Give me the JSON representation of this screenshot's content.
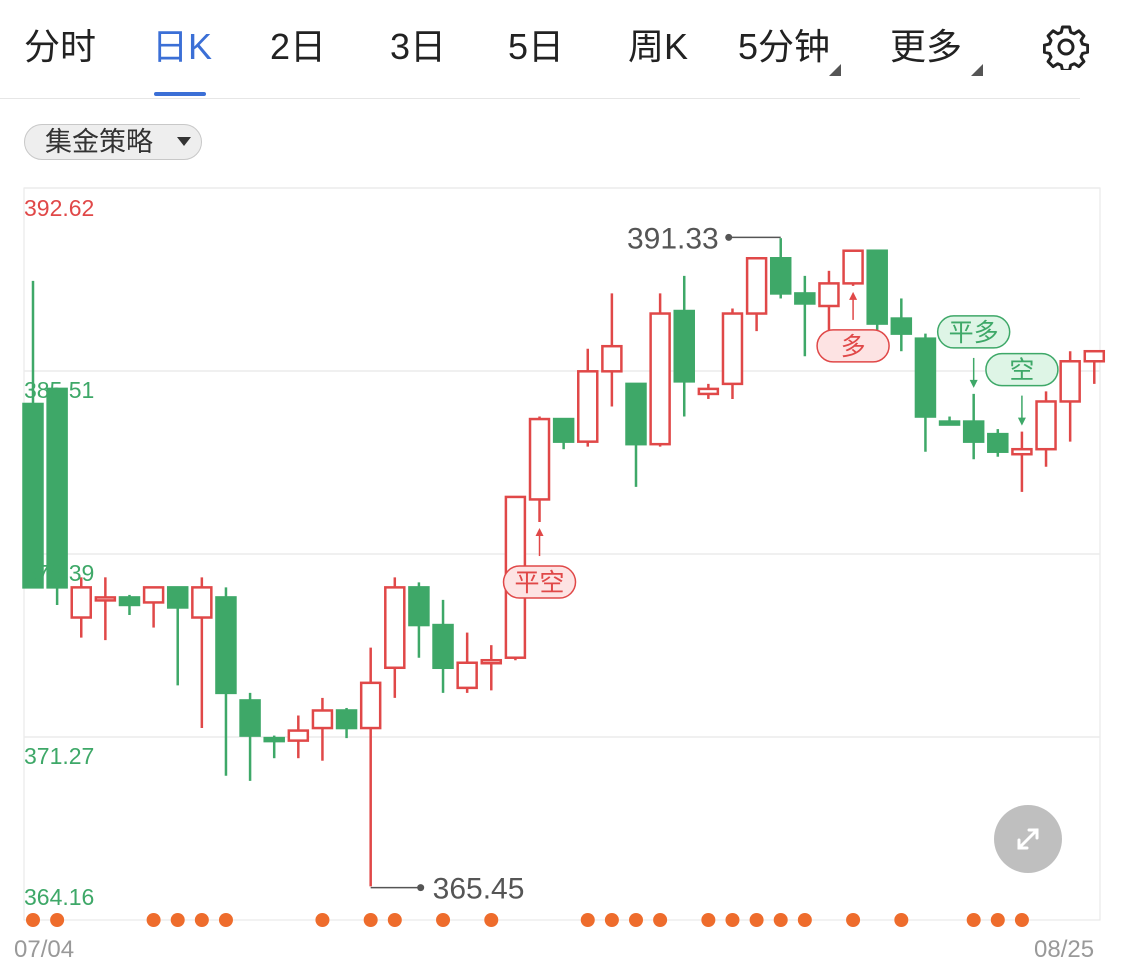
{
  "tabs": [
    {
      "label": "分时",
      "active": false,
      "has_menu": false
    },
    {
      "label": "日K",
      "active": true,
      "has_menu": false
    },
    {
      "label": "2日",
      "active": false,
      "has_menu": false
    },
    {
      "label": "3日",
      "active": false,
      "has_menu": false
    },
    {
      "label": "5日",
      "active": false,
      "has_menu": false
    },
    {
      "label": "周K",
      "active": false,
      "has_menu": false
    },
    {
      "label": "5分钟",
      "active": false,
      "has_menu": true
    },
    {
      "label": "更多",
      "active": false,
      "has_menu": true
    }
  ],
  "settings_icon": "gear-icon",
  "expand_icon": "expand-icon",
  "strategy_dropdown": {
    "label": "集金策略"
  },
  "colors": {
    "up": "#e04848",
    "down": "#3ea868",
    "accent": "#3b6fd6",
    "dot": "#ee6c2c",
    "signal_red_bg": "#fde3e3",
    "signal_green_bg": "#def5e6"
  },
  "chart_data": {
    "type": "candlestick",
    "title": "",
    "ylim": [
      364.16,
      392.62
    ],
    "y_ticks": [
      "392.62",
      "385.51",
      "378.39",
      "371.27",
      "364.16"
    ],
    "x_start_label": "07/04",
    "x_end_label": "08/25",
    "high_marker": {
      "label": "391.33",
      "value": 391.33,
      "index": 31
    },
    "low_marker": {
      "label": "365.45",
      "value": 365.45,
      "index": 14
    },
    "candles": [
      {
        "o": 377.4,
        "h": 389.6,
        "l": 384.2,
        "c": 384.7,
        "dir": "down"
      },
      {
        "o": 377.4,
        "h": 381.2,
        "l": 376.7,
        "c": 385.3,
        "dir": "down"
      },
      {
        "o": 377.4,
        "h": 377.8,
        "l": 375.4,
        "c": 376.2,
        "dir": "up"
      },
      {
        "o": 377.0,
        "h": 377.8,
        "l": 375.3,
        "c": 377.0,
        "dir": "up"
      },
      {
        "o": 376.7,
        "h": 377.1,
        "l": 376.3,
        "c": 377.0,
        "dir": "down"
      },
      {
        "o": 376.8,
        "h": 377.4,
        "l": 375.8,
        "c": 377.4,
        "dir": "up"
      },
      {
        "o": 376.6,
        "h": 377.4,
        "l": 373.5,
        "c": 377.4,
        "dir": "down"
      },
      {
        "o": 377.4,
        "h": 377.8,
        "l": 371.8,
        "c": 376.2,
        "dir": "up"
      },
      {
        "o": 377.0,
        "h": 377.4,
        "l": 369.9,
        "c": 373.2,
        "dir": "down"
      },
      {
        "o": 372.9,
        "h": 373.2,
        "l": 369.7,
        "c": 371.5,
        "dir": "down"
      },
      {
        "o": 371.4,
        "h": 371.5,
        "l": 370.6,
        "c": 371.3,
        "dir": "down"
      },
      {
        "o": 371.3,
        "h": 372.3,
        "l": 370.6,
        "c": 371.7,
        "dir": "up"
      },
      {
        "o": 371.8,
        "h": 373.0,
        "l": 370.5,
        "c": 372.5,
        "dir": "up"
      },
      {
        "o": 372.5,
        "h": 372.6,
        "l": 371.4,
        "c": 371.8,
        "dir": "down"
      },
      {
        "o": 371.8,
        "h": 375.0,
        "l": 365.5,
        "c": 373.6,
        "dir": "up"
      },
      {
        "o": 374.2,
        "h": 377.8,
        "l": 373.0,
        "c": 377.4,
        "dir": "up"
      },
      {
        "o": 377.4,
        "h": 377.6,
        "l": 374.6,
        "c": 375.9,
        "dir": "down"
      },
      {
        "o": 375.9,
        "h": 376.9,
        "l": 373.2,
        "c": 374.2,
        "dir": "down"
      },
      {
        "o": 373.4,
        "h": 375.6,
        "l": 373.2,
        "c": 374.4,
        "dir": "up"
      },
      {
        "o": 374.5,
        "h": 375.1,
        "l": 373.3,
        "c": 374.5,
        "dir": "up"
      },
      {
        "o": 374.6,
        "h": 381.0,
        "l": 374.5,
        "c": 381.0,
        "dir": "up"
      },
      {
        "o": 380.9,
        "h": 384.2,
        "l": 380.0,
        "c": 384.1,
        "dir": "up"
      },
      {
        "o": 384.1,
        "h": 384.1,
        "l": 382.9,
        "c": 383.2,
        "dir": "down"
      },
      {
        "o": 383.2,
        "h": 386.9,
        "l": 383.0,
        "c": 386.0,
        "dir": "up"
      },
      {
        "o": 386.0,
        "h": 389.1,
        "l": 384.6,
        "c": 387.0,
        "dir": "up"
      },
      {
        "o": 385.5,
        "h": 385.5,
        "l": 381.4,
        "c": 383.1,
        "dir": "down"
      },
      {
        "o": 383.1,
        "h": 389.1,
        "l": 383.0,
        "c": 388.3,
        "dir": "up"
      },
      {
        "o": 388.4,
        "h": 389.8,
        "l": 384.2,
        "c": 385.6,
        "dir": "down"
      },
      {
        "o": 385.3,
        "h": 385.5,
        "l": 384.9,
        "c": 385.1,
        "dir": "up"
      },
      {
        "o": 385.5,
        "h": 388.5,
        "l": 384.9,
        "c": 388.3,
        "dir": "up"
      },
      {
        "o": 388.3,
        "h": 390.5,
        "l": 387.6,
        "c": 390.5,
        "dir": "up"
      },
      {
        "o": 390.5,
        "h": 391.3,
        "l": 388.9,
        "c": 389.1,
        "dir": "down"
      },
      {
        "o": 389.1,
        "h": 389.8,
        "l": 386.6,
        "c": 388.7,
        "dir": "down"
      },
      {
        "o": 388.6,
        "h": 390.0,
        "l": 387.5,
        "c": 389.5,
        "dir": "up"
      },
      {
        "o": 389.5,
        "h": 390.8,
        "l": 389.4,
        "c": 390.8,
        "dir": "up"
      },
      {
        "o": 390.8,
        "h": 390.8,
        "l": 386.5,
        "c": 387.9,
        "dir": "down"
      },
      {
        "o": 388.1,
        "h": 388.9,
        "l": 386.8,
        "c": 387.5,
        "dir": "down"
      },
      {
        "o": 387.3,
        "h": 387.5,
        "l": 382.8,
        "c": 384.2,
        "dir": "down"
      },
      {
        "o": 384.0,
        "h": 384.2,
        "l": 384.2,
        "c": 384.0,
        "dir": "down"
      },
      {
        "o": 384.0,
        "h": 385.1,
        "l": 382.5,
        "c": 383.2,
        "dir": "down"
      },
      {
        "o": 383.5,
        "h": 383.7,
        "l": 382.6,
        "c": 382.8,
        "dir": "down"
      },
      {
        "o": 382.7,
        "h": 383.6,
        "l": 381.2,
        "c": 382.9,
        "dir": "up"
      },
      {
        "o": 382.9,
        "h": 385.2,
        "l": 382.2,
        "c": 384.8,
        "dir": "up"
      },
      {
        "o": 384.8,
        "h": 386.8,
        "l": 383.2,
        "c": 386.4,
        "dir": "up"
      },
      {
        "o": 386.4,
        "h": 386.8,
        "l": 385.5,
        "c": 386.8,
        "dir": "up"
      }
    ],
    "signals": [
      {
        "text": "平空",
        "index": 21,
        "color": "red",
        "position": "below"
      },
      {
        "text": "多",
        "index": 34,
        "color": "red",
        "position": "below"
      },
      {
        "text": "平多",
        "index": 39,
        "color": "green",
        "position": "above"
      },
      {
        "text": "空",
        "index": 41,
        "color": "green",
        "position": "above"
      }
    ],
    "dot_indices": [
      0,
      1,
      5,
      6,
      7,
      8,
      12,
      14,
      15,
      17,
      19,
      23,
      24,
      25,
      26,
      28,
      29,
      30,
      31,
      32,
      34,
      36,
      39,
      40,
      41
    ]
  }
}
